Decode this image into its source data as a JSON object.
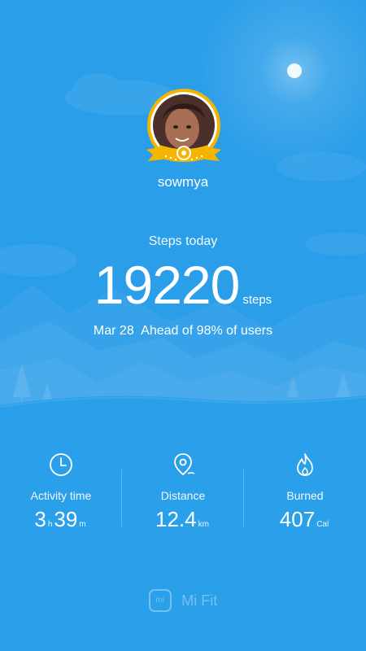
{
  "user": {
    "name": "sowmya"
  },
  "steps": {
    "label": "Steps today",
    "value": "19220",
    "unit": "steps"
  },
  "summary": {
    "date": "Mar 28",
    "text": "Ahead of 98% of users"
  },
  "stats": [
    {
      "icon": "clock-icon",
      "label": "Activity time",
      "hours": "3",
      "hours_unit": "h",
      "minutes": "39",
      "minutes_unit": "m"
    },
    {
      "icon": "location-pin-icon",
      "label": "Distance",
      "value": "12.4",
      "unit": "km"
    },
    {
      "icon": "flame-icon",
      "label": "Burned",
      "value": "407",
      "unit": "Cal"
    }
  ],
  "footer": {
    "brand": "Mi Fit",
    "logo_text": "mi"
  },
  "colors": {
    "background": "#2c9fea",
    "badge": "#f4b400"
  }
}
